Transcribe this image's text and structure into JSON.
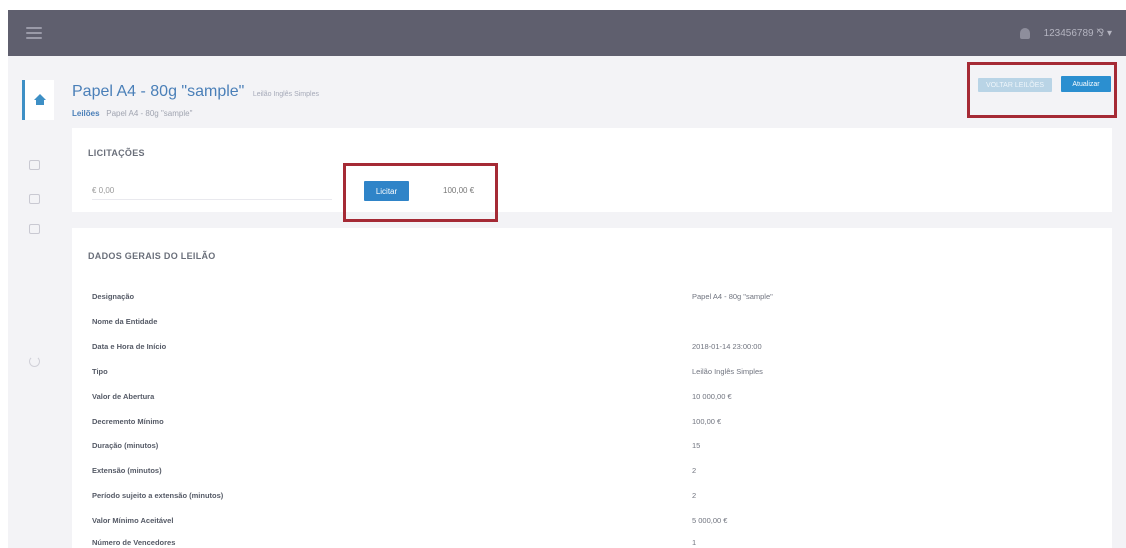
{
  "navbar": {
    "username": "123456789 ⅋ ▾"
  },
  "sidebar": {
    "icons": [
      "home-icon",
      "list-icon",
      "docs-icon",
      "briefcase-icon",
      "power-icon"
    ]
  },
  "header": {
    "title": "Papel A4 - 80g \"sample\"",
    "subtitle": "Leilão Inglês Simples",
    "breadcrumb": {
      "root": "Leilões",
      "current": "Papel A4 - 80g \"sample\""
    },
    "back_label": "VOLTAR LEILÕES",
    "refresh_label": "Atualizar"
  },
  "bids": {
    "title": "LICITAÇÕES",
    "input_placeholder": "€ 0,00",
    "bid_button": "Licitar",
    "min_value": "100,00 €"
  },
  "details": {
    "title": "DADOS GERAIS DO LEILÃO",
    "rows": [
      {
        "label": "Designação",
        "value": "Papel A4 - 80g \"sample\""
      },
      {
        "label": "Nome da Entidade",
        "value": ""
      },
      {
        "label": "Data e Hora de Início",
        "value": "2018-01-14 23:00:00"
      },
      {
        "label": "Tipo",
        "value": "Leilão Inglês Simples"
      },
      {
        "label": "Valor de Abertura",
        "value": "10 000,00 €"
      },
      {
        "label": "Decremento Mínimo",
        "value": "100,00 €"
      },
      {
        "label": "Duração (minutos)",
        "value": "15"
      },
      {
        "label": "Extensão (minutos)",
        "value": "2"
      },
      {
        "label": "Período sujeito a extensão (minutos)",
        "value": "2"
      },
      {
        "label": "Valor Mínimo Aceitável",
        "value": "5 000,00 €"
      },
      {
        "label": "Número de Vencedores",
        "value": "1"
      }
    ]
  }
}
